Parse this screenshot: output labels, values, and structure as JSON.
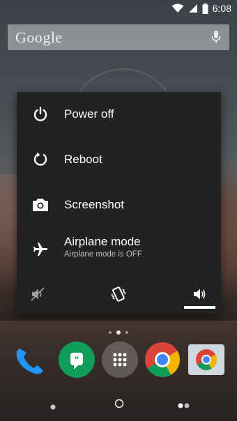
{
  "status_bar": {
    "time": "6:08",
    "icons": [
      "wifi-icon",
      "signal-icon",
      "battery-icon"
    ]
  },
  "search_widget": {
    "logo_text": "Google",
    "icons": [
      "mic-icon"
    ]
  },
  "power_menu": {
    "items": [
      {
        "label": "Power off",
        "icon": "power-icon"
      },
      {
        "label": "Reboot",
        "icon": "reboot-icon"
      },
      {
        "label": "Screenshot",
        "icon": "camera-icon"
      },
      {
        "label": "Airplane mode",
        "sublabel": "Airplane mode is OFF",
        "icon": "airplane-icon"
      }
    ],
    "sound_modes": [
      {
        "name": "silent",
        "icon": "silent-icon"
      },
      {
        "name": "vibrate",
        "icon": "vibrate-icon"
      },
      {
        "name": "sound",
        "icon": "sound-on-icon",
        "selected": true
      }
    ]
  },
  "dock": {
    "apps": [
      "phone-icon",
      "hangouts-icon",
      "app-drawer-icon",
      "chrome-icon",
      "camera-app-icon"
    ]
  },
  "nav_bar": {
    "buttons": [
      "back-button",
      "home-button",
      "recents-button"
    ]
  },
  "colors": {
    "dialog_bg": "#222222",
    "sublabel": "#bdbdbd",
    "phone_blue": "#2196f3",
    "hangouts_green": "#0f9d58"
  }
}
